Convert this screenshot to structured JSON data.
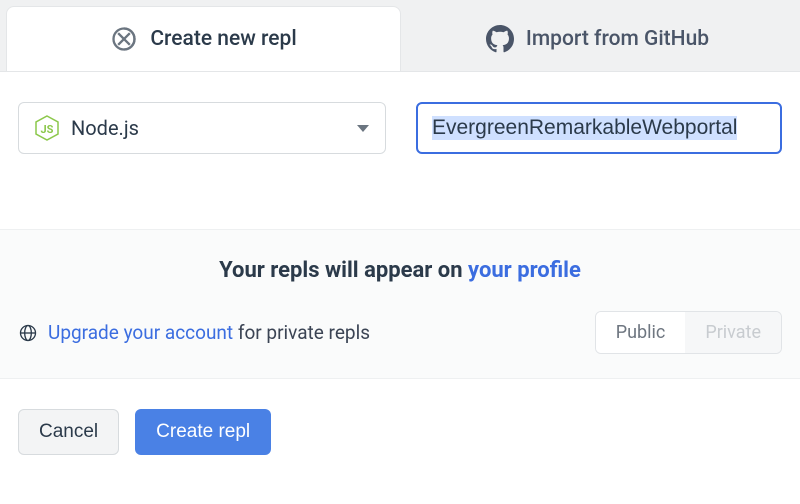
{
  "tabs": {
    "create": "Create new repl",
    "import": "Import from GitHub"
  },
  "language": {
    "selected": "Node.js"
  },
  "name_input": {
    "value": "EvergreenRemarkableWebportal"
  },
  "info": {
    "headline_prefix": "Your repls will appear on ",
    "headline_link": "your profile",
    "upgrade_link": "Upgrade your account",
    "upgrade_suffix": " for private repls",
    "visibility": {
      "public": "Public",
      "private": "Private"
    }
  },
  "footer": {
    "cancel": "Cancel",
    "create": "Create repl"
  }
}
